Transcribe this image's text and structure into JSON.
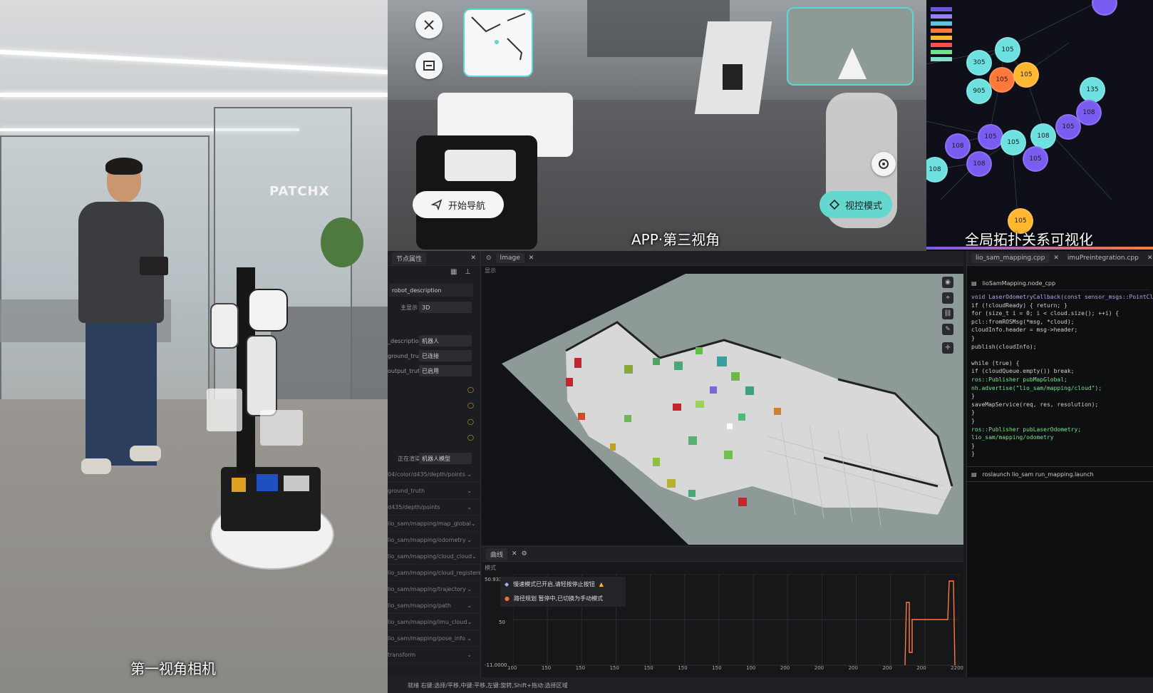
{
  "left_camera": {
    "caption": "第一视角相机",
    "sign_text": "PATCHX"
  },
  "app_view": {
    "caption": "APP·第三视角",
    "start_nav_label": "开始导航",
    "mode_label": "视控模式"
  },
  "topology": {
    "caption": "全局拓扑关系可视化",
    "nodes": [
      "105",
      "305",
      "105",
      "105",
      "905",
      "105",
      "135",
      "108",
      "105",
      "108",
      "105",
      "105",
      "108",
      "105",
      "108",
      "108",
      "105"
    ]
  },
  "software": {
    "left_panel": {
      "tab_title": "节点属性",
      "header_field": "robot_description",
      "rows": [
        {
          "label": "主显示",
          "value": "3D"
        },
        {
          "label": "_description",
          "value": "机器人"
        },
        {
          "label": "ground_truth",
          "value": "已连接"
        },
        {
          "label": "output_truth",
          "value": "已启用"
        },
        {
          "label": "正在渲染",
          "value": "机器人模型"
        }
      ],
      "topics": [
        "04/color/d435/depth/points",
        "ground_truth",
        "d435/depth/points",
        "lio_sam/mapping/map_global",
        "lio_sam/mapping/odometry",
        "lio_sam/mapping/cloud_cloud",
        "lio_sam/mapping/cloud_registered",
        "lio_sam/mapping/trajectory",
        "lio_sam/mapping/path",
        "lio_sam/mapping/imu_cloud",
        "lio_sam/mapping/pose_info",
        "transform"
      ]
    },
    "map_panel": {
      "tab_label": "Image",
      "toolbar_label": "显示"
    },
    "plot_panel": {
      "tab_label": "曲线",
      "toolbar_label": "模式",
      "y_max": "50.9336",
      "y_mid": "50",
      "y_min": "-11.0000",
      "x_ticks": [
        "100",
        "150",
        "150",
        "150",
        "150",
        "150",
        "150",
        "100",
        "200",
        "200",
        "200",
        "200",
        "200",
        "2200"
      ],
      "legend": [
        {
          "text": "慢速模式已开启,请轻按停止按钮",
          "color": "#9bb2ff"
        },
        {
          "text": "路径规划 暂停中,已切换为手动模式",
          "color": "#ff6a3d"
        }
      ]
    },
    "code_panel": {
      "tabs": [
        "lio_sam_mapping.cpp",
        "imuPreintegration.cpp"
      ],
      "file_title": "lioSamMapping.node_cpp",
      "lines": [
        {
          "t": "void LaserOdometryCallback(const sensor_msgs::PointCloud2::ConstPtr& msg)",
          "c": "#b8a6e8"
        },
        {
          "t": "  if (!cloudReady) { return; }",
          "c": "#d0d0d0"
        },
        {
          "t": "  for (size_t i = 0; i < cloud.size(); ++i) {",
          "c": "#d0d0d0"
        },
        {
          "t": "    pcl::fromROSMsg(*msg, *cloud);",
          "c": "#d0d0d0"
        },
        {
          "t": "    cloudInfo.header = msg->header;",
          "c": "#d0d0d0"
        },
        {
          "t": "  }",
          "c": "#d0d0d0"
        },
        {
          "t": "  publish(cloudInfo);",
          "c": "#d0d0d0"
        },
        {
          "t": "",
          "c": "#d0d0d0"
        },
        {
          "t": "  while (true) {",
          "c": "#d0d0d0"
        },
        {
          "t": "    if (cloudQueue.empty()) break;",
          "c": "#d0d0d0"
        },
        {
          "t": "      ros::Publisher pubMapGlobal;",
          "c": "#7ee08e"
        },
        {
          "t": "      nh.advertise(\"lio_sam/mapping/cloud\");",
          "c": "#7ee08e"
        },
        {
          "t": "    }",
          "c": "#d0d0d0"
        },
        {
          "t": "  saveMapService(req, res, resolution);",
          "c": "#d0d0d0"
        },
        {
          "t": "    }",
          "c": "#d0d0d0"
        },
        {
          "t": "    }",
          "c": "#d0d0d0"
        },
        {
          "t": "      ros::Publisher pubLaserOdometry;",
          "c": "#7ee08e"
        },
        {
          "t": "      lio_sam/mapping/odometry",
          "c": "#7ee08e"
        },
        {
          "t": "  }",
          "c": "#d0d0d0"
        },
        {
          "t": "}",
          "c": "#d0d0d0"
        }
      ],
      "launch_title": "roslaunch lio_sam run_mapping.launch"
    },
    "status_bar": "就绪 右键:选择/平移,中键:平移,左键:旋转,Shift+拖动:选择区域"
  },
  "colors": {
    "accent_teal": "#5fd6cf",
    "node_cyan": "#6ee0e0",
    "node_orange": "#ff7a3a",
    "node_yellow": "#ffb730",
    "node_purple": "#7b5cf0"
  }
}
